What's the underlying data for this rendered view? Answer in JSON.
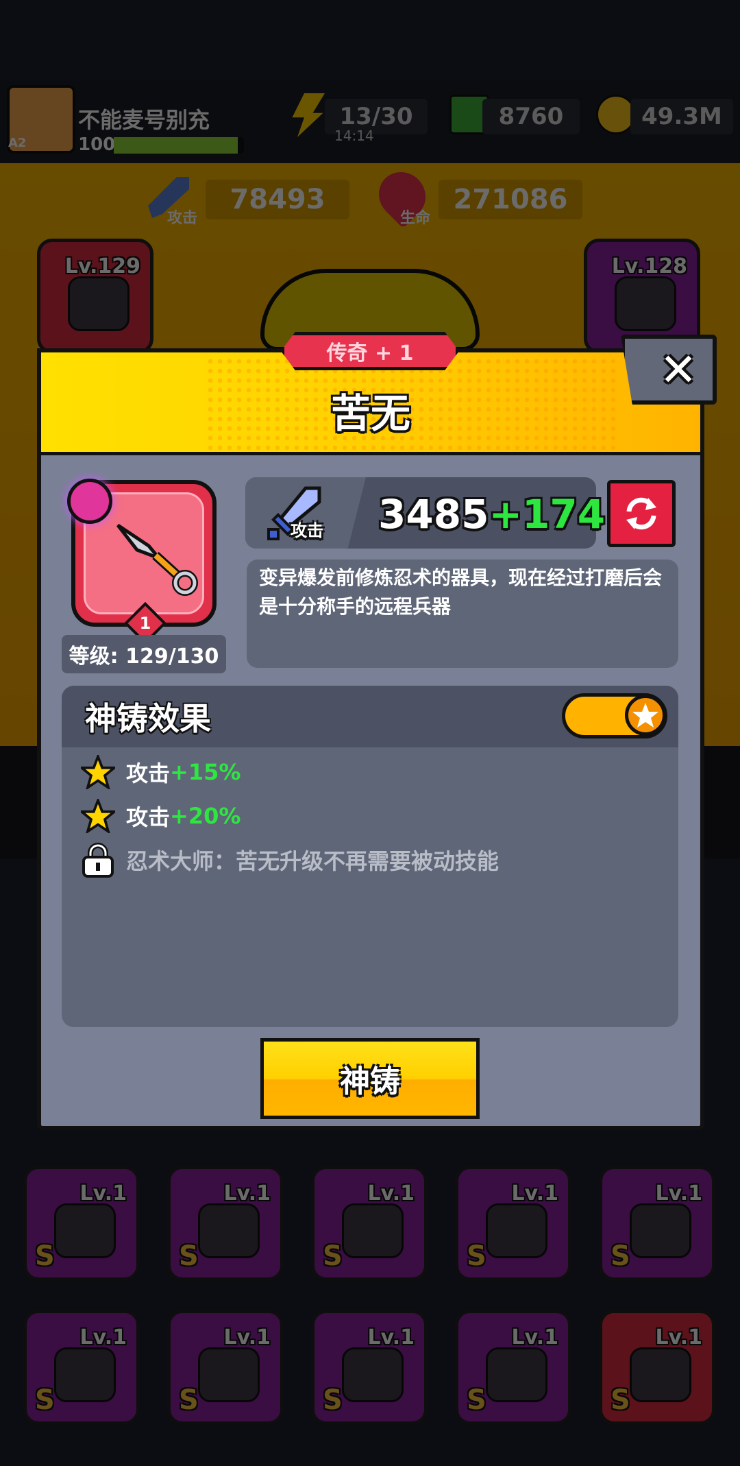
{
  "player": {
    "name": "不能麦号别充",
    "level": "100",
    "badge": "A2"
  },
  "resources": {
    "energy": "13/30",
    "energy_timer": "14:14",
    "gems": "8760",
    "gold": "49.3M"
  },
  "stats": {
    "attack_label": "攻击",
    "attack": "78493",
    "hp_label": "生命",
    "hp": "271086"
  },
  "background_slots": {
    "left_top_level": "Lv.129",
    "right_top_level": "Lv.128",
    "row1_levels": [
      "Lv.1",
      "Lv.1",
      "Lv.1",
      "Lv.1",
      "Lv.1"
    ],
    "row2_levels": [
      "Lv.1",
      "Lv.1",
      "Lv.1",
      "Lv.1",
      "Lv.1"
    ],
    "grade": "S"
  },
  "modal": {
    "rarity": "传奇 + 1",
    "title": "苦无",
    "close_glyph": "✕",
    "item_badge": "1",
    "level_text": "等级: 129/130",
    "attack_label": "攻击",
    "attack_base": "3485",
    "attack_bonus": "+174",
    "description": "变异爆发前修炼忍术的器具，现在经过打磨后会是十分称手的远程兵器",
    "effects_title": "神铸效果",
    "effects": [
      {
        "label": "攻击",
        "bonus": "+15%",
        "locked": false
      },
      {
        "label": "攻击",
        "bonus": "+20%",
        "locked": false
      },
      {
        "label": "忍术大师：苦无升级不再需要被动技能",
        "bonus": "",
        "locked": true
      }
    ],
    "forge_button": "神铸"
  },
  "colors": {
    "accent_yellow": "#ffd400",
    "bonus_green": "#2ee640",
    "legend_red": "#e8334e",
    "locked_gray": "#b9bdc7"
  }
}
